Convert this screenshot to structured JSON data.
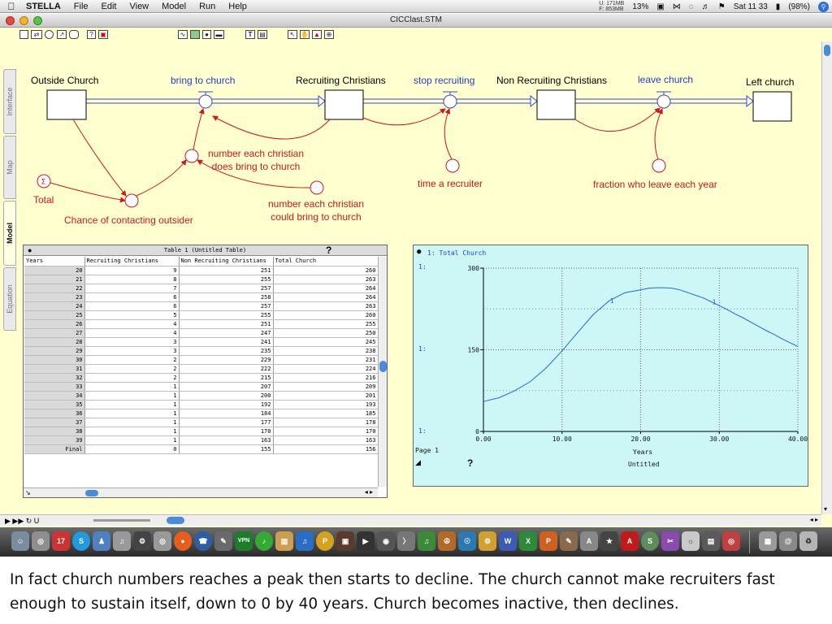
{
  "menubar": {
    "app": "STELLA",
    "items": [
      "File",
      "Edit",
      "View",
      "Model",
      "Run",
      "Help"
    ],
    "memory_u": "U: 171MB",
    "memory_f": "F: 853MB",
    "cpu": "13%",
    "clock": "Sat 11 33",
    "battery": "(98%)"
  },
  "window": {
    "title": "CICClast.STM",
    "side_tabs": [
      "Interface",
      "Map",
      "Model",
      "Equation"
    ],
    "active_tab": "Model"
  },
  "model": {
    "stocks": [
      "Outside Church",
      "Recruiting Christians",
      "Non Recruiting Christians",
      "Left church"
    ],
    "flows": [
      "bring to church",
      "stop recruiting",
      "leave church"
    ],
    "converters": {
      "bring": [
        "number each christian",
        "does bring to church"
      ],
      "could": [
        "number each christian",
        "could bring to church"
      ],
      "chance": "Chance of contacting outsider",
      "total": "Total",
      "time_recruiter": "time a recruiter",
      "fraction_leave": "fraction who leave each year"
    }
  },
  "table": {
    "title": "Table 1 (Untitled Table)",
    "help": "?",
    "columns": [
      "Years",
      "Recruiting Christians",
      "Non Recruiting Christians",
      "Total Church"
    ],
    "rows": [
      [
        "20",
        "9",
        "251",
        "260"
      ],
      [
        "21",
        "8",
        "255",
        "263"
      ],
      [
        "22",
        "7",
        "257",
        "264"
      ],
      [
        "23",
        "6",
        "258",
        "264"
      ],
      [
        "24",
        "6",
        "257",
        "263"
      ],
      [
        "25",
        "5",
        "255",
        "260"
      ],
      [
        "26",
        "4",
        "251",
        "255"
      ],
      [
        "27",
        "4",
        "247",
        "250"
      ],
      [
        "28",
        "3",
        "241",
        "245"
      ],
      [
        "29",
        "3",
        "235",
        "238"
      ],
      [
        "30",
        "2",
        "229",
        "231"
      ],
      [
        "31",
        "2",
        "222",
        "224"
      ],
      [
        "32",
        "2",
        "215",
        "216"
      ],
      [
        "33",
        "1",
        "207",
        "209"
      ],
      [
        "34",
        "1",
        "200",
        "201"
      ],
      [
        "35",
        "1",
        "192",
        "193"
      ],
      [
        "36",
        "1",
        "184",
        "185"
      ],
      [
        "37",
        "1",
        "177",
        "178"
      ],
      [
        "38",
        "1",
        "170",
        "170"
      ],
      [
        "39",
        "1",
        "163",
        "163"
      ],
      [
        "Final",
        "0",
        "155",
        "156"
      ]
    ]
  },
  "graph": {
    "series_label": "1: Total Church",
    "page": "Page 1",
    "help": "?",
    "title": "Untitled",
    "axis_tag": "1:"
  },
  "chart_data": {
    "type": "line",
    "title": "Untitled",
    "xlabel": "Years",
    "ylabel": "",
    "xlim": [
      0,
      40
    ],
    "ylim": [
      0,
      300
    ],
    "x_ticks": [
      "0.00",
      "10.00",
      "20.00",
      "30.00",
      "40.00"
    ],
    "y_ticks": [
      "0",
      "150",
      "300"
    ],
    "grid": true,
    "series": [
      {
        "name": "Total Church",
        "x": [
          0,
          2,
          4,
          6,
          8,
          10,
          12,
          14,
          16,
          18,
          20,
          21,
          22,
          23,
          24,
          25,
          26,
          27,
          28,
          29,
          30,
          31,
          32,
          33,
          34,
          35,
          36,
          37,
          38,
          39,
          40
        ],
        "y": [
          55,
          62,
          75,
          92,
          117,
          148,
          182,
          215,
          240,
          255,
          260,
          263,
          264,
          264,
          263,
          260,
          255,
          250,
          245,
          238,
          231,
          224,
          216,
          209,
          201,
          193,
          185,
          178,
          170,
          163,
          156
        ]
      }
    ]
  },
  "caption": "In fact church numbers reaches a peak then starts to decline. The church cannot make recruiters fast enough to sustain itself, down to 0 by 40 years. Church becomes inactive, then declines."
}
